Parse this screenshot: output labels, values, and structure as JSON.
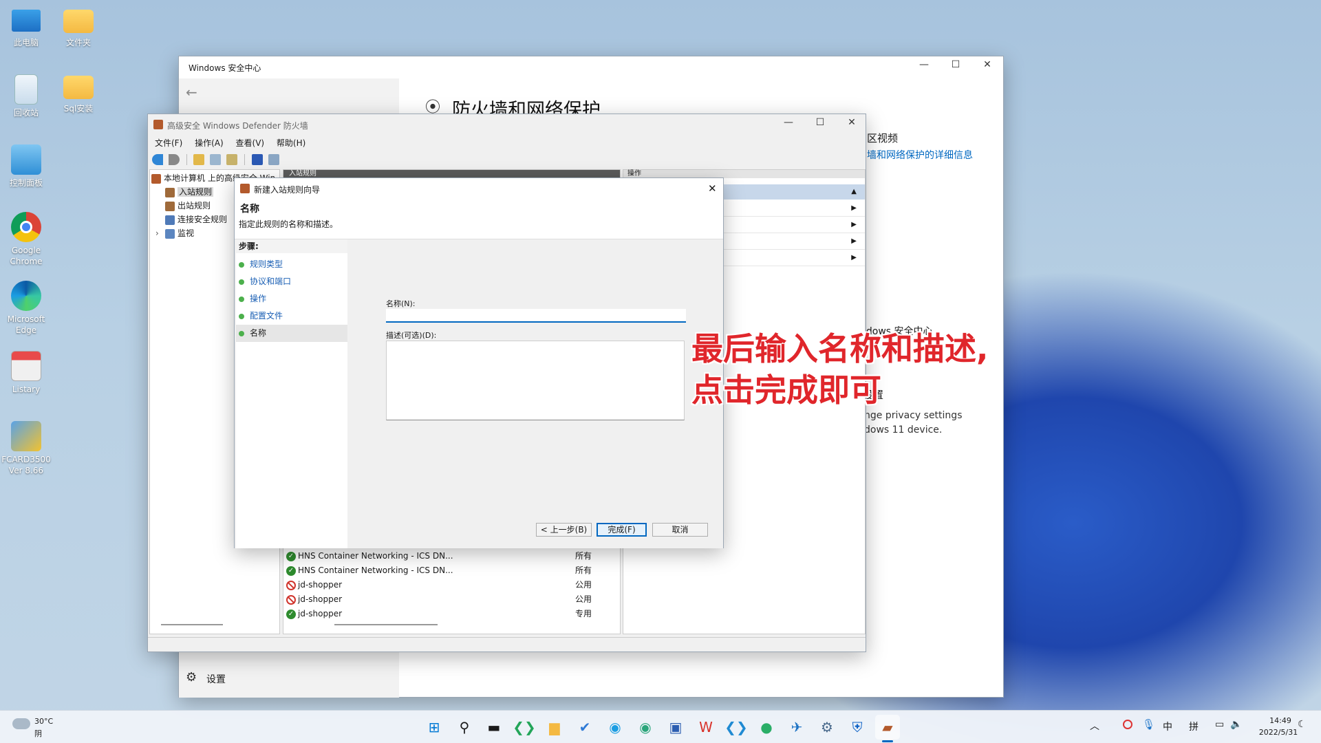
{
  "desktop": {
    "icons": [
      {
        "label": "此电脑"
      },
      {
        "label": "文件夹"
      },
      {
        "label": "回收站"
      },
      {
        "label": "Sql安装"
      },
      {
        "label": "控制面板"
      },
      {
        "label": "Google Chrome"
      },
      {
        "label": "Microsoft Edge"
      },
      {
        "label": "Listary"
      },
      {
        "label": "FCARD3500 Ver 8.66"
      }
    ]
  },
  "security_center": {
    "title": "Windows 安全中心",
    "heading": "防火墙和网络保护",
    "side_text_1": "区视频",
    "side_link": "墙和网络保护的详细信息",
    "side_text_2": "ndows 安全中心",
    "side_text_3": "设置",
    "side_text_4": "nge privacy settings",
    "side_text_5": "dows 11 device.",
    "settings_label": "设置"
  },
  "firewall": {
    "title": "高级安全 Windows Defender 防火墙",
    "menu": [
      "文件(F)",
      "操作(A)",
      "查看(V)",
      "帮助(H)"
    ],
    "tree_root": "本地计算机 上的高级安全 Win",
    "tree_items": [
      "入站规则",
      "出站规则",
      "连接安全规则",
      "监视"
    ],
    "center_header": "入站规则",
    "actions_header": "操作",
    "rules": [
      {
        "name": "HNS Container Networking - ICS DN...",
        "profile": "所有",
        "status": "ok"
      },
      {
        "name": "HNS Container Networking - ICS DN...",
        "profile": "所有",
        "status": "ok"
      },
      {
        "name": "jd-shopper",
        "profile": "公用",
        "status": "blocked"
      },
      {
        "name": "jd-shopper",
        "profile": "公用",
        "status": "blocked"
      },
      {
        "name": "jd-shopper",
        "profile": "专用",
        "status": "ok"
      }
    ]
  },
  "wizard": {
    "title": "新建入站规则向导",
    "section_title": "名称",
    "section_desc": "指定此规则的名称和描述。",
    "steps_label": "步骤:",
    "steps": [
      "规则类型",
      "协议和端口",
      "操作",
      "配置文件",
      "名称"
    ],
    "name_label": "名称(N):",
    "name_value": "",
    "desc_label": "描述(可选)(D):",
    "desc_value": "",
    "back_button": "< 上一步(B)",
    "finish_button": "完成(F)",
    "cancel_button": "取消"
  },
  "annotation": {
    "line1": "最后输入名称和描述,",
    "line2": "点击完成即可"
  },
  "taskbar": {
    "weather_temp": "30°C",
    "weather_desc": "阴",
    "ime_lang": "中",
    "ime_mode": "拼",
    "time": "14:49",
    "date": "2022/5/31"
  },
  "colors": {
    "accent": "#0067c0",
    "annotation": "#e0262b",
    "link": "#1a5fb4"
  }
}
